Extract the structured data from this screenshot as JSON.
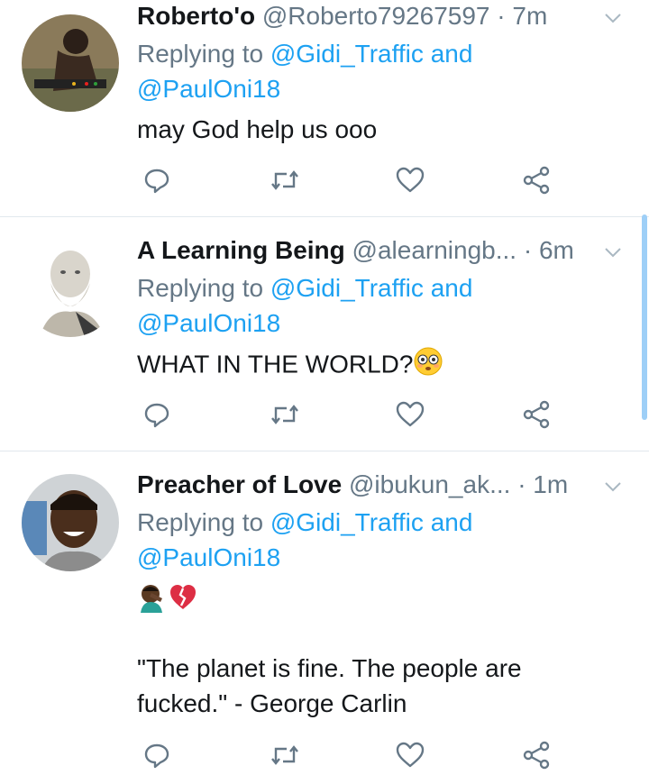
{
  "tweets": [
    {
      "name": "Roberto'o",
      "handle": "@Roberto79267597",
      "sep": "·",
      "time": "7m",
      "replying_prefix": "Replying to",
      "mention1": "@Gidi_Traffic",
      "and": "and",
      "mention2": "@PaulOni18",
      "text": "may God help us ooo"
    },
    {
      "name": "A Learning Being",
      "handle": "@alearningb...",
      "sep": "·",
      "time": "6m",
      "replying_prefix": "Replying to",
      "mention1": "@Gidi_Traffic",
      "and": "and",
      "mention2": "@PaulOni18",
      "text": "WHAT IN THE WORLD?"
    },
    {
      "name": "Preacher of Love",
      "handle": "@ibukun_ak...",
      "sep": "·",
      "time": "1m",
      "replying_prefix": "Replying to",
      "mention1": "@Gidi_Traffic",
      "and": "and",
      "mention2": "@PaulOni18",
      "text_line2": "\"The planet is fine. The people are",
      "text_line3": "fucked.\" - George Carlin"
    }
  ],
  "icons": {
    "reply": "reply-icon",
    "retweet": "retweet-icon",
    "like": "like-icon",
    "share": "share-icon",
    "caret": "chevron-down-icon"
  },
  "colors": {
    "mention": "#1da1f2",
    "muted": "#657786",
    "divider": "#e1e8ed"
  }
}
